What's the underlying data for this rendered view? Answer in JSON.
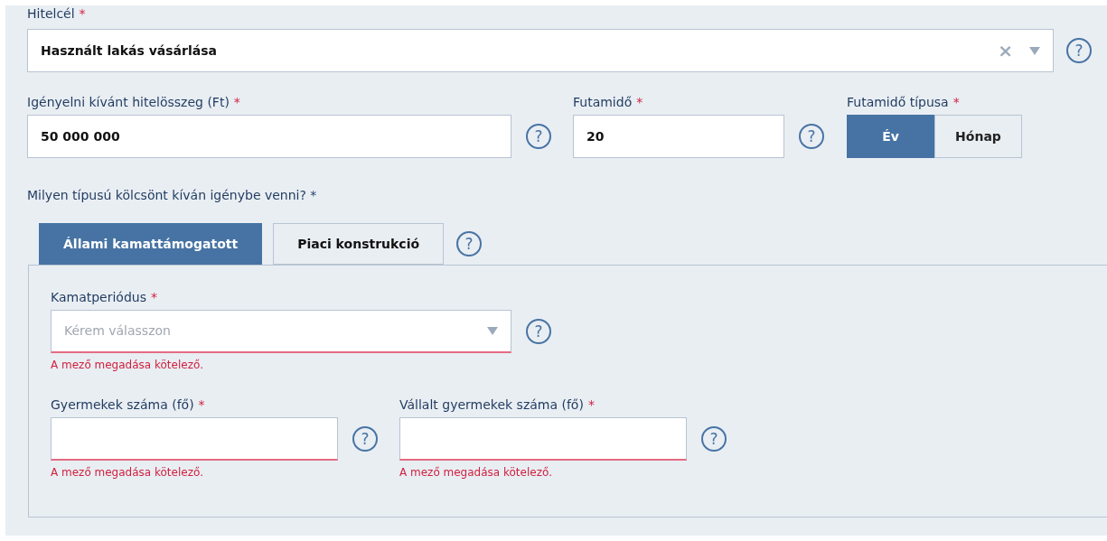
{
  "loan_purpose": {
    "label": "Hitelcél",
    "required_mark": "*",
    "value": "Használt lakás vásárlása",
    "clear_icon": "×",
    "help": "?"
  },
  "amount": {
    "label": "Igényelni kívánt hitelösszeg (Ft)",
    "required_mark": "*",
    "value": "50 000 000",
    "help": "?"
  },
  "term": {
    "label": "Futamidő",
    "required_mark": "*",
    "value": "20",
    "help": "?"
  },
  "term_type": {
    "label": "Futamidő típusa",
    "required_mark": "*",
    "options": [
      {
        "label": "Év",
        "selected": true
      },
      {
        "label": "Hónap",
        "selected": false
      }
    ]
  },
  "loan_type_question": "Milyen típusú kölcsönt kíván igénybe venni? *",
  "loan_types": {
    "tabs": [
      {
        "label": "Állami kamattámogatott",
        "selected": true
      },
      {
        "label": "Piaci konstrukció",
        "selected": false
      }
    ],
    "help": "?"
  },
  "interest_period": {
    "label": "Kamatperiódus",
    "required_mark": "*",
    "placeholder": "Kérem válasszon",
    "invalid": true,
    "error": "A mező megadása kötelező.",
    "help": "?"
  },
  "children": [
    {
      "label": "Gyermekek száma (fő)",
      "required_mark": "*",
      "invalid": true,
      "error": "A mező megadása kötelező.",
      "help": "?"
    },
    {
      "label": "Vállalt gyermekek száma (fő)",
      "required_mark": "*",
      "invalid": true,
      "error": "A mező megadása kötelező.",
      "help": "?"
    }
  ]
}
